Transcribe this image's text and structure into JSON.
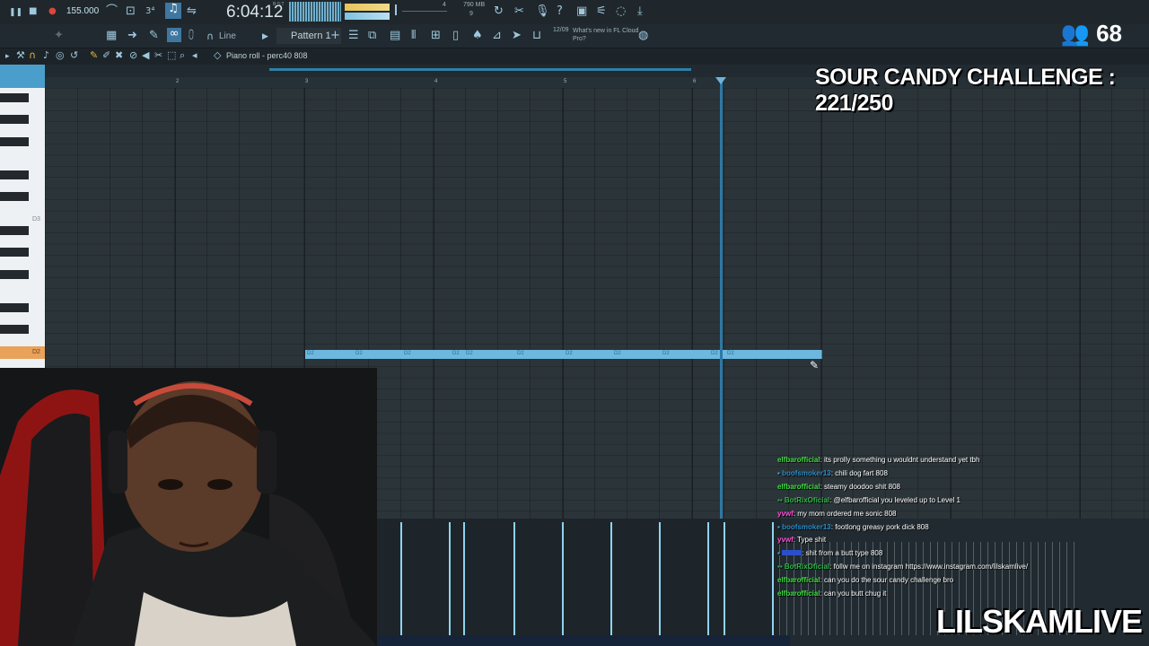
{
  "toolbar": {
    "tempo": "155.000",
    "time": "6:04:12",
    "time_unit": "B:S:T",
    "memory": "790 MB",
    "voices": "4",
    "cpu": "9",
    "snap": "Line",
    "pattern": "Pattern 1",
    "news_date": "12/09",
    "news_text": "What's new in FL Cloud Pro?"
  },
  "piano_roll": {
    "title": "Piano roll - perc40 808",
    "bar_numbers": [
      "2",
      "3",
      "4",
      "5",
      "6"
    ],
    "key_labels": [
      "D3",
      "D2"
    ],
    "note_label": "D2",
    "note_count": 11
  },
  "overlay": {
    "viewers": "68",
    "challenge": "SOUR CANDY CHALLENGE : 221/250",
    "brand": "LILSKAMLIVE"
  },
  "chat": [
    {
      "user": "elfbarofficial",
      "text": ": its prolly something u wouldnt understand yet tbh",
      "color": "#3fe03f"
    },
    {
      "user": "boofsmoker13",
      "text": ": chili dog fart 808",
      "color": "#2b8ec9"
    },
    {
      "user": "elfbarofficial",
      "text": ": steamy doodoo shit 808",
      "color": "#3fe03f"
    },
    {
      "user": "BotRixOficial",
      "text": ": @elfbarofficial you leveled up to Level 1",
      "color": "#2fb84a"
    },
    {
      "user": "yvwf",
      "text": ": my mom ordered me sonic 808",
      "color": "#ff4fd8"
    },
    {
      "user": "boofsmoker13",
      "text": ": footlong greasy pork dick 808",
      "color": "#2b8ec9"
    },
    {
      "user": "yvwf",
      "text": ": Type shit",
      "color": "#ff4fd8"
    },
    {
      "user": "",
      "text": ": shit from a butt type 808",
      "color": "#2b4fc9"
    },
    {
      "user": "BotRixOficial",
      "text": ": follw me on instagram https://www.instagram.com/lilskamlive/",
      "color": "#2fb84a"
    },
    {
      "user": "elfbarofficial",
      "text": ": can you do the sour candy challenge bro",
      "color": "#3fe03f"
    },
    {
      "user": "elfbarofficial",
      "text": ": can you butt chug it",
      "color": "#3fe03f"
    }
  ]
}
